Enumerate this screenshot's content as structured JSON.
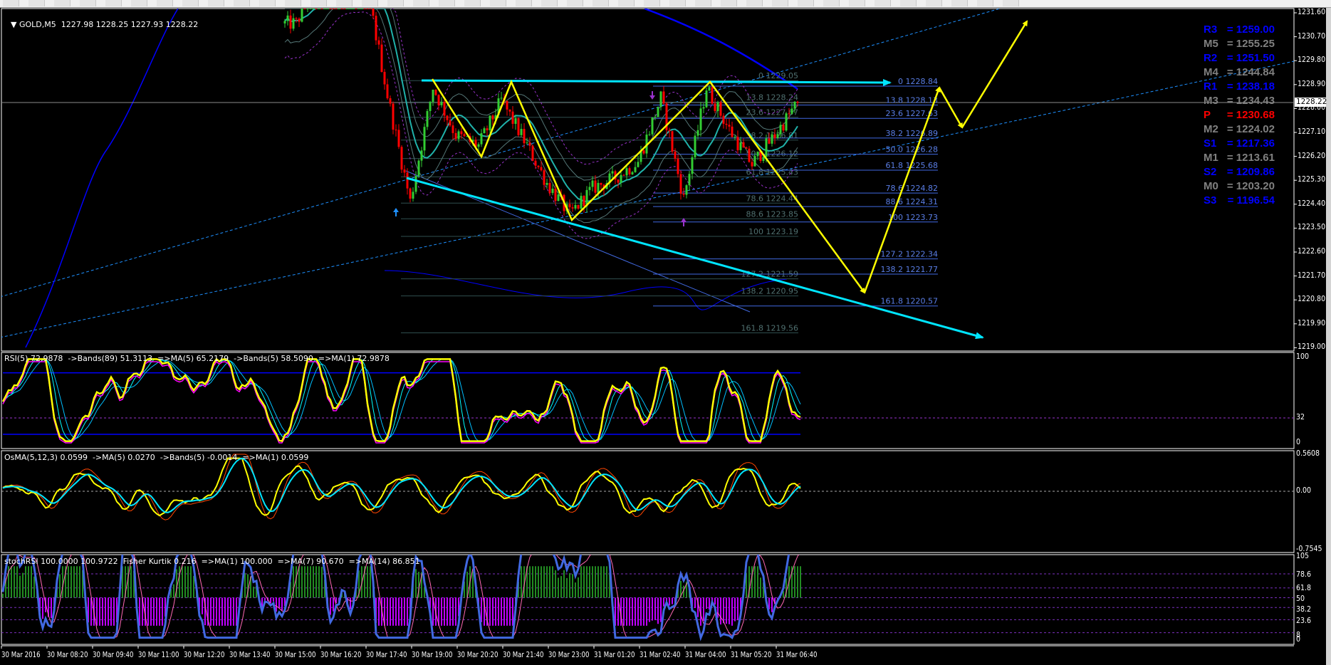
{
  "symbol_header": {
    "symbol": "GOLD,M5",
    "open": "1227.98",
    "high": "1228.25",
    "low": "1227.93",
    "close": "1228.22"
  },
  "current_price": "1228.22",
  "price_axis": [
    "1231.60",
    "1230.70",
    "1229.80",
    "1228.90",
    "1228.00",
    "1227.10",
    "1226.20",
    "1225.30",
    "1224.40",
    "1223.50",
    "1222.60",
    "1221.70",
    "1220.80",
    "1219.90",
    "1219.00"
  ],
  "pivots": [
    {
      "name": "R3",
      "value": "= 1259.00",
      "color": "#0000ff"
    },
    {
      "name": "M5",
      "value": "= 1255.25",
      "color": "#808080"
    },
    {
      "name": "R2",
      "value": "= 1251.50",
      "color": "#0000ff"
    },
    {
      "name": "M4",
      "value": "= 1244.84",
      "color": "#808080"
    },
    {
      "name": "R1",
      "value": "= 1238.18",
      "color": "#0000ff"
    },
    {
      "name": "M3",
      "value": "= 1234.43",
      "color": "#808080"
    },
    {
      "name": "P",
      "value": "= 1230.68",
      "color": "#ff0000"
    },
    {
      "name": "M2",
      "value": "= 1224.02",
      "color": "#808080"
    },
    {
      "name": "S1",
      "value": "= 1217.36",
      "color": "#0000ff"
    },
    {
      "name": "M1",
      "value": "= 1213.61",
      "color": "#808080"
    },
    {
      "name": "S2",
      "value": "= 1209.86",
      "color": "#0000ff"
    },
    {
      "name": "M0",
      "value": "= 1203.20",
      "color": "#808080"
    },
    {
      "name": "S3",
      "value": "= 1196.54",
      "color": "#0000ff"
    }
  ],
  "fib_left": [
    {
      "level": "0",
      "price": 1229.05,
      "label": "0 1229.05"
    },
    {
      "level": "13.8",
      "price": 1228.24,
      "label": "13.8 1228.24"
    },
    {
      "level": "23.6",
      "price": 1227.67,
      "label": "23.6 1227.67"
    },
    {
      "level": "38.2",
      "price": 1226.81,
      "label": "38.2 1226.81"
    },
    {
      "level": "50.0",
      "price": 1226.12,
      "label": "50.0 1226.12"
    },
    {
      "level": "61.8",
      "price": 1225.43,
      "label": "61.8 1225.43"
    },
    {
      "level": "78.6",
      "price": 1224.44,
      "label": "78.6 1224.44"
    },
    {
      "level": "88.6",
      "price": 1223.85,
      "label": "88.6 1223.85"
    },
    {
      "level": "100",
      "price": 1223.19,
      "label": "100 1223.19"
    },
    {
      "level": "127.2",
      "price": 1221.59,
      "label": "127.2 1221.59"
    },
    {
      "level": "138.2",
      "price": 1220.95,
      "label": "138.2 1220.95"
    },
    {
      "level": "161.8",
      "price": 1219.56,
      "label": "161.8 1219.56"
    }
  ],
  "fib_right": [
    {
      "level": "0",
      "price": 1228.84,
      "label": "0 1228.84"
    },
    {
      "level": "13.8",
      "price": 1228.13,
      "label": "13.8 1228.13"
    },
    {
      "level": "23.6",
      "price": 1227.63,
      "label": "23.6 1227.63"
    },
    {
      "level": "38.2",
      "price": 1226.89,
      "label": "38.2 1226.89"
    },
    {
      "level": "50.0",
      "price": 1226.28,
      "label": "50.0 1226.28"
    },
    {
      "level": "61.8",
      "price": 1225.68,
      "label": "61.8 1225.68"
    },
    {
      "level": "78.6",
      "price": 1224.82,
      "label": "78.6 1224.82"
    },
    {
      "level": "88.6",
      "price": 1224.31,
      "label": "88.6 1224.31"
    },
    {
      "level": "100",
      "price": 1223.73,
      "label": "100 1223.73"
    },
    {
      "level": "127.2",
      "price": 1222.34,
      "label": "127.2 1222.34"
    },
    {
      "level": "138.2",
      "price": 1221.77,
      "label": "138.2 1221.77"
    },
    {
      "level": "161.8",
      "price": 1220.57,
      "label": "161.8 1220.57"
    }
  ],
  "price_path": [
    1231.2,
    1233,
    1233,
    1233,
    1228.5,
    1224.5,
    1228.8,
    1227.0,
    1226.6,
    1228.3,
    1226.8,
    1225.2,
    1224.0,
    1225.0,
    1225.4,
    1226.0,
    1228.4,
    1224.6,
    1228.8,
    1227.2,
    1225.9,
    1227.0,
    1228.22
  ],
  "rsi": {
    "header": "RSI(5) 72.9878  ->Bands(89) 51.3113  =>MA(5) 65.2179  ->Bands(5) 58.5090  =>MA(1) 72.9878",
    "axis": [
      "100",
      "32",
      "0"
    ]
  },
  "osma": {
    "header": "OsMA(5,12,3) 0.0599  ->MA(5) 0.0270  ->Bands(5) -0.0014  =>MA(1) 0.0599",
    "axis": [
      "0.5608",
      "0.00",
      "-0.7545"
    ]
  },
  "stoch": {
    "header": "stochRSI 100.0000 100.9722  Fisher Kurtik 0.216  =>MA(1) 100.000  =>MA(7) 90.670  =>MA(14) 86.851",
    "axis": [
      "105",
      "78.6",
      "61.8",
      "50",
      "38.2",
      "23.6",
      "8",
      "0"
    ]
  },
  "time_axis": [
    "30 Mar 2016",
    "30 Mar 08:20",
    "30 Mar 09:40",
    "30 Mar 11:00",
    "30 Mar 12:20",
    "30 Mar 13:40",
    "30 Mar 15:00",
    "30 Mar 16:20",
    "30 Mar 17:40",
    "30 Mar 19:00",
    "30 Mar 20:20",
    "30 Mar 21:40",
    "30 Mar 23:00",
    "31 Mar 01:20",
    "31 Mar 02:40",
    "31 Mar 04:00",
    "31 Mar 05:20",
    "31 Mar 06:40"
  ],
  "colors": {
    "bull": "#32cd32",
    "bear": "#ff0000",
    "zigzag": "#ffff00",
    "channel": "#00e5ff",
    "fib_right": "#4169e1",
    "fib_left": "#2f4f4f",
    "trend_dotted": "#1e90ff"
  }
}
